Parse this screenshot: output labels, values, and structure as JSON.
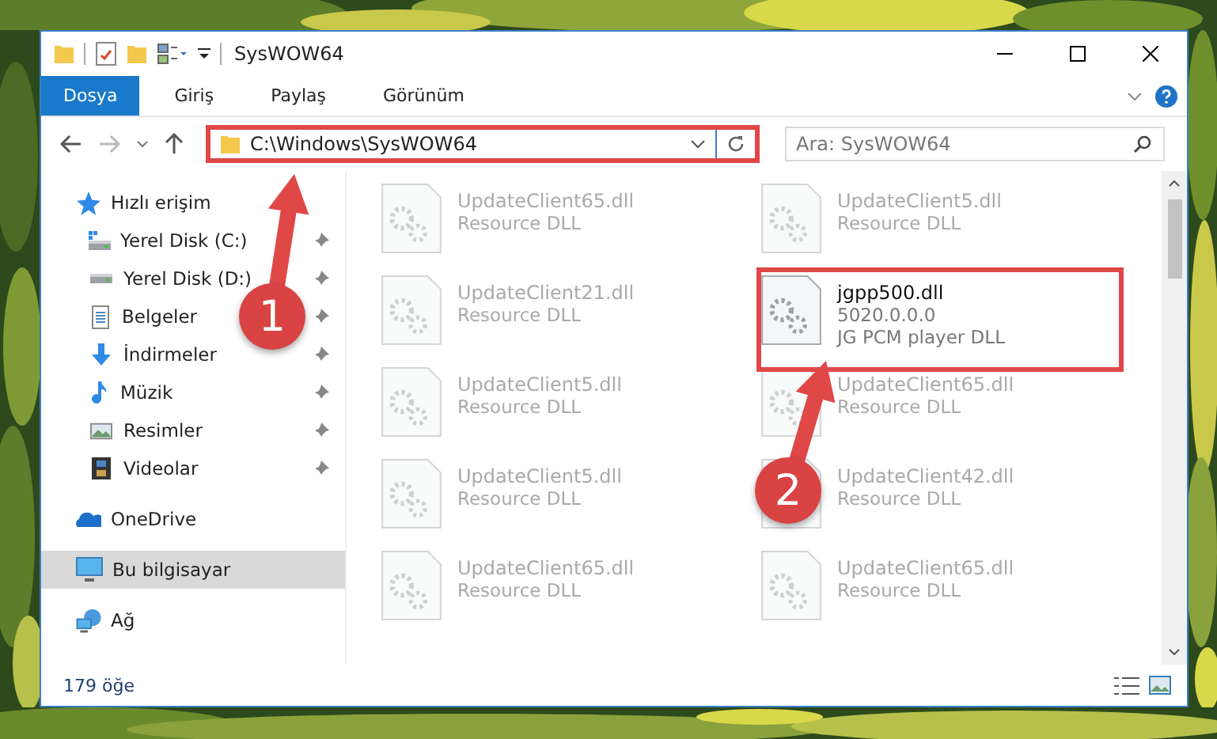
{
  "window": {
    "title": "SysWOW64"
  },
  "ribbon_tabs": [
    {
      "label": "Dosya",
      "selected": true
    },
    {
      "label": "Giriş",
      "selected": false
    },
    {
      "label": "Paylaş",
      "selected": false
    },
    {
      "label": "Görünüm",
      "selected": false
    }
  ],
  "address": {
    "value": "C:\\Windows\\SysWOW64"
  },
  "search": {
    "placeholder": "Ara: SysWOW64"
  },
  "navigation": [
    {
      "label": "Hızlı erişim",
      "kind": "star",
      "selected": false,
      "children": [
        {
          "label": "Yerel Disk (C:)",
          "kind": "drive-windows",
          "pinned": true
        },
        {
          "label": "Yerel Disk (D:)",
          "kind": "drive",
          "pinned": true
        },
        {
          "label": "Belgeler",
          "kind": "documents",
          "pinned": true
        },
        {
          "label": "İndirmeler",
          "kind": "download",
          "pinned": true
        },
        {
          "label": "Müzik",
          "kind": "music",
          "pinned": true
        },
        {
          "label": "Resimler",
          "kind": "pictures",
          "pinned": true
        },
        {
          "label": "Videolar",
          "kind": "videos",
          "pinned": true
        }
      ]
    },
    {
      "label": "OneDrive",
      "kind": "cloud",
      "selected": false
    },
    {
      "label": "Bu bilgisayar",
      "kind": "computer",
      "selected": true
    },
    {
      "label": "Ağ",
      "kind": "network",
      "selected": false
    }
  ],
  "files": [
    {
      "name": "UpdateClient65.dll",
      "details": [
        "Resource DLL"
      ],
      "blurred": true
    },
    {
      "name": "UpdateClient5.dll",
      "details": [
        "Resource DLL"
      ],
      "blurred": true
    },
    {
      "name": "UpdateClient21.dll",
      "details": [
        "Resource DLL"
      ],
      "blurred": true
    },
    {
      "name": "jgpp500.dll",
      "details": [
        "5020.0.0.0",
        "JG PCM player DLL"
      ],
      "blurred": false
    },
    {
      "name": "UpdateClient5.dll",
      "details": [
        "Resource DLL"
      ],
      "blurred": true
    },
    {
      "name": "UpdateClient65.dll",
      "details": [
        "Resource DLL"
      ],
      "blurred": true
    },
    {
      "name": "UpdateClient5.dll",
      "details": [
        "Resource DLL"
      ],
      "blurred": true
    },
    {
      "name": "UpdateClient42.dll",
      "details": [
        "Resource DLL"
      ],
      "blurred": true
    },
    {
      "name": "UpdateClient65.dll",
      "details": [
        "Resource DLL"
      ],
      "blurred": true
    },
    {
      "name": "UpdateClient65.dll",
      "details": [
        "Resource DLL"
      ],
      "blurred": true
    }
  ],
  "status_bar": {
    "count": "179 öğe"
  },
  "annotations": [
    {
      "number": "1"
    },
    {
      "number": "2"
    }
  ]
}
